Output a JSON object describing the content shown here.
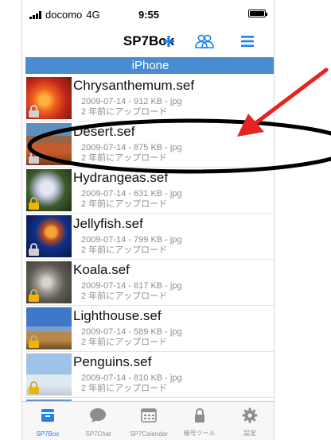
{
  "status_bar": {
    "carrier": "docomo",
    "network": "4G",
    "time": "9:55"
  },
  "nav": {
    "title": "SP7Box",
    "add_icon": "plus-icon",
    "share_icon": "users-icon",
    "menu_icon": "hamburger-icon"
  },
  "section_header": "iPhone",
  "files": [
    {
      "name": "Chrysanthemum.sef",
      "meta": "2009-07-14 - 912 KB - jpg",
      "uploaded": "2 年前にアップロード",
      "lock": "gray"
    },
    {
      "name": "Desert.sef",
      "meta": "2009-07-14 - 875 KB - jpg",
      "uploaded": "2 年前にアップロード",
      "lock": "gray"
    },
    {
      "name": "Hydrangeas.sef",
      "meta": "2009-07-14 - 631 KB - jpg",
      "uploaded": "2 年前にアップロード",
      "lock": "gold"
    },
    {
      "name": "Jellyfish.sef",
      "meta": "2009-07-14 - 799 KB - jpg",
      "uploaded": "2 年前にアップロード",
      "lock": "gray"
    },
    {
      "name": "Koala.sef",
      "meta": "2009-07-14 - 817 KB - jpg",
      "uploaded": "2 年前にアップロード",
      "lock": "gold"
    },
    {
      "name": "Lighthouse.sef",
      "meta": "2009-07-14 - 589 KB - jpg",
      "uploaded": "2 年前にアップロード",
      "lock": "gold"
    },
    {
      "name": "Penguins.sef",
      "meta": "2009-07-14 - 810 KB - jpg",
      "uploaded": "2 年前にアップロード",
      "lock": "gold"
    }
  ],
  "tabs": [
    {
      "label": "SP7Box",
      "icon": "box-icon",
      "active": true
    },
    {
      "label": "SP7Chat",
      "icon": "chat-bubble-icon",
      "active": false
    },
    {
      "label": "SP7Calendar",
      "icon": "calendar-icon",
      "active": false
    },
    {
      "label": "暗号ツール",
      "icon": "lock-icon",
      "active": false
    },
    {
      "label": "設定",
      "icon": "gear-icon",
      "active": false
    }
  ],
  "colors": {
    "accent": "#1a82f2",
    "section_header": "#4a8ccf",
    "annotation_arrow": "#e8231f",
    "annotation_ellipse": "#000000"
  }
}
